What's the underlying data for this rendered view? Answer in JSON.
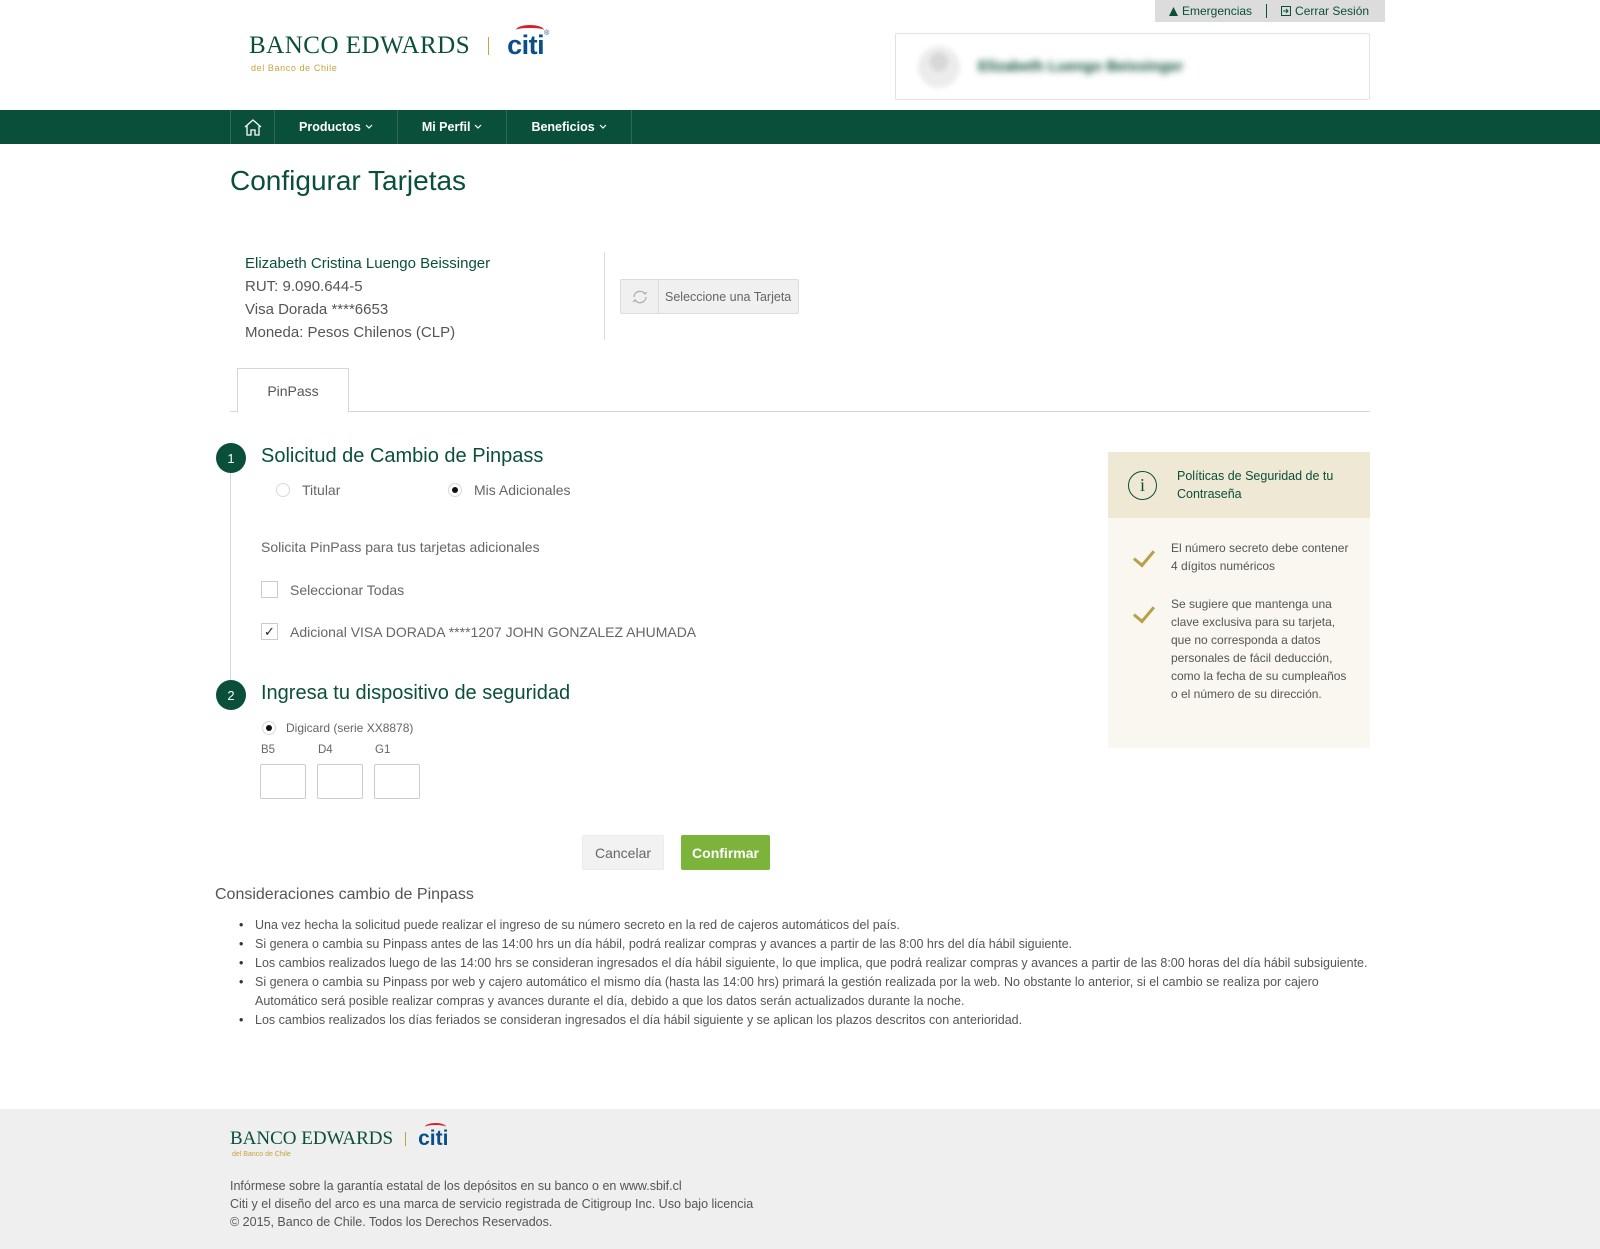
{
  "topbar": {
    "emergencias": "Emergencias",
    "cerrar_sesion": "Cerrar Sesión"
  },
  "brand": {
    "bank": "BANCO EDWARDS",
    "partner": "citi",
    "subtitle": "del Banco de Chile"
  },
  "user": {
    "name": "Elizabeth Luengo Beissinger"
  },
  "nav": {
    "items": [
      {
        "label": "Productos"
      },
      {
        "label": "Mi Perfil"
      },
      {
        "label": "Beneficios"
      }
    ]
  },
  "page": {
    "title": "Configurar Tarjetas"
  },
  "card_info": {
    "owner": "Elizabeth Cristina Luengo Beissinger",
    "rut": "RUT: 9.090.644-5",
    "card": "Visa Dorada ****6653",
    "currency": "Moneda: Pesos Chilenos (CLP)",
    "select_button": "Seleccione una Tarjeta"
  },
  "tabs": [
    {
      "label": "PinPass",
      "active": true
    }
  ],
  "step1": {
    "number": "1",
    "title": "Solicitud de Cambio de Pinpass",
    "options": [
      {
        "label": "Titular",
        "selected": false
      },
      {
        "label": "Mis Adicionales",
        "selected": true
      }
    ],
    "instruction": "Solicita PinPass para tus tarjetas adicionales",
    "select_all": {
      "label": "Seleccionar Todas",
      "checked": false
    },
    "additional": {
      "label": "Adicional VISA DORADA ****1207 JOHN GONZALEZ AHUMADA",
      "checked": true
    }
  },
  "step2": {
    "number": "2",
    "title": "Ingresa tu dispositivo de seguridad",
    "device": {
      "label": "Digicard (serie XX8878)",
      "selected": true
    },
    "coordinates": [
      {
        "label": "B5",
        "value": ""
      },
      {
        "label": "D4",
        "value": ""
      },
      {
        "label": "G1",
        "value": ""
      }
    ]
  },
  "actions": {
    "cancel": "Cancelar",
    "confirm": "Confirmar"
  },
  "security_panel": {
    "title": "Políticas de Seguridad de tu Contraseña",
    "tips": [
      "El número secreto debe contener 4 dígitos numéricos",
      "Se sugiere que mantenga una clave exclusiva para su tarjeta, que no corresponda a datos personales de fácil deducción, como la fecha de su cumpleaños o el número de su dirección."
    ]
  },
  "considerations": {
    "title": "Consideraciones cambio de Pinpass",
    "items": [
      "Una vez hecha la solicitud puede realizar el ingreso de su número secreto en la red de cajeros automáticos del país.",
      "Si genera o cambia su Pinpass antes de las 14:00 hrs un día hábil, podrá realizar compras y avances a partir de las 8:00 hrs del día hábil siguiente.",
      "Los cambios realizados luego de las 14:00 hrs se consideran ingresados el día hábil siguiente, lo que implica, que podrá realizar compras y avances a partir de las 8:00 horas del día hábil subsiguiente.",
      "Si genera o cambia su Pinpass por web y cajero automático el mismo día (hasta las 14:00 hrs) primará la gestión realizada por la web. No obstante lo anterior, si el cambio se realiza por cajero Automático será posible realizar compras y avances durante el día, debido a que los datos serán actualizados durante la noche.",
      "Los cambios realizados los días feriados se consideran ingresados el día hábil siguiente y se aplican los plazos descritos con anterioridad."
    ]
  },
  "footer": {
    "line1": "Infórmese sobre la garantía estatal de los depósitos en su banco o en www.sbif.cl",
    "line2": "Citi y el diseño del arco es una marca de servicio registrada de Citigroup Inc. Uso bajo licencia",
    "line3": "© 2015, Banco de Chile. Todos los Derechos Reservados."
  },
  "colors": {
    "brand_green": "#0a4f3a",
    "confirm_green": "#7bb33b",
    "gold": "#c8a23a",
    "citi_blue": "#0b4f8a",
    "citi_red": "#d2232a"
  }
}
